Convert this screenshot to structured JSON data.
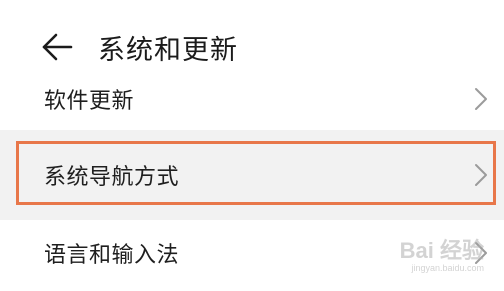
{
  "header": {
    "title": "系统和更新",
    "back_icon": "arrow-left-icon"
  },
  "rows": [
    {
      "label": "软件更新",
      "icon": "chevron-right-icon"
    },
    {
      "label": "系统导航方式",
      "icon": "chevron-right-icon",
      "highlighted": true
    },
    {
      "label": "语言和输入法",
      "icon": "chevron-right-icon"
    }
  ],
  "colors": {
    "highlight_border": "#e8774a",
    "selected_row_bg": "#f2f2f2",
    "chevron": "#9b9b9b"
  },
  "watermark": {
    "brand": "Bai 经验",
    "url": "jingyan.baidu.com"
  }
}
